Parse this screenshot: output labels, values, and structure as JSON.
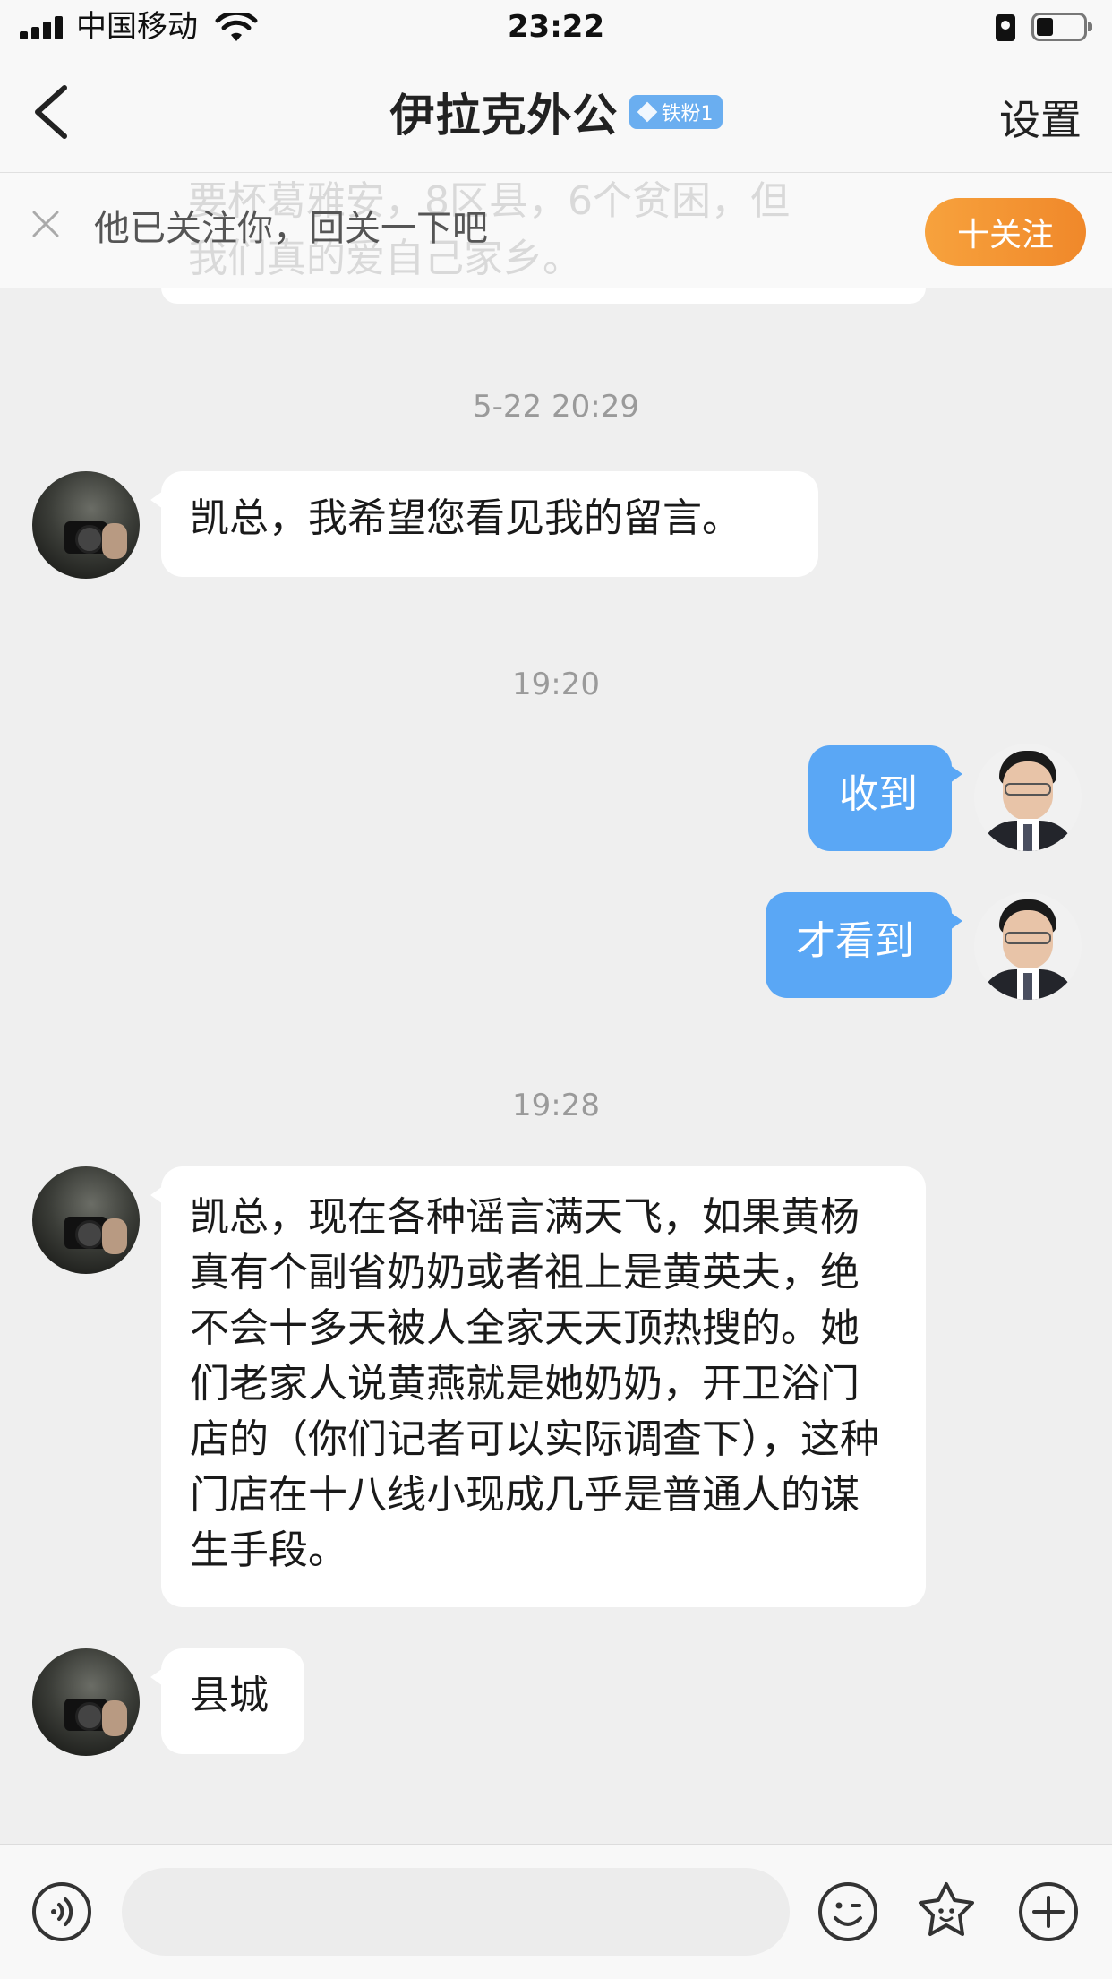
{
  "status_bar": {
    "carrier": "中国移动",
    "time": "23:22"
  },
  "nav": {
    "title": "伊拉克外公",
    "fan_badge": "铁粉1",
    "settings_label": "设置"
  },
  "follow_banner": {
    "ghost_line_1": "要杯葛雅安，8区县，6个贫困，但",
    "ghost_line_2": "我们真的爱自己家乡。",
    "text": "他已关注你，回关一下吧",
    "follow_button": "十关注"
  },
  "messages": [
    {
      "type": "timestamp",
      "text": "5-22 20:29"
    },
    {
      "type": "incoming",
      "text": "凯总，我希望您看见我的留言。"
    },
    {
      "type": "timestamp",
      "text": "19:20"
    },
    {
      "type": "outgoing",
      "text": "收到"
    },
    {
      "type": "outgoing",
      "text": "才看到"
    },
    {
      "type": "timestamp",
      "text": "19:28"
    },
    {
      "type": "incoming",
      "text": "凯总，现在各种谣言满天飞，如果黄杨真有个副省奶奶或者祖上是黄英夫，绝不会十多天被人全家天天顶热搜的。她们老家人说黄燕就是她奶奶，开卫浴门店的（你们记者可以实际调查下），这种门店在十八线小现成几乎是普通人的谋生手段。"
    },
    {
      "type": "incoming",
      "text": "县城"
    }
  ],
  "input_bar": {
    "placeholder": "",
    "icons": [
      "voice-icon",
      "emoji-icon",
      "sticker-icon",
      "plus-icon"
    ]
  },
  "colors": {
    "outgoing_bubble": "#5aa7f5",
    "follow_button": "#f39632",
    "fan_badge": "#6aaef0"
  }
}
